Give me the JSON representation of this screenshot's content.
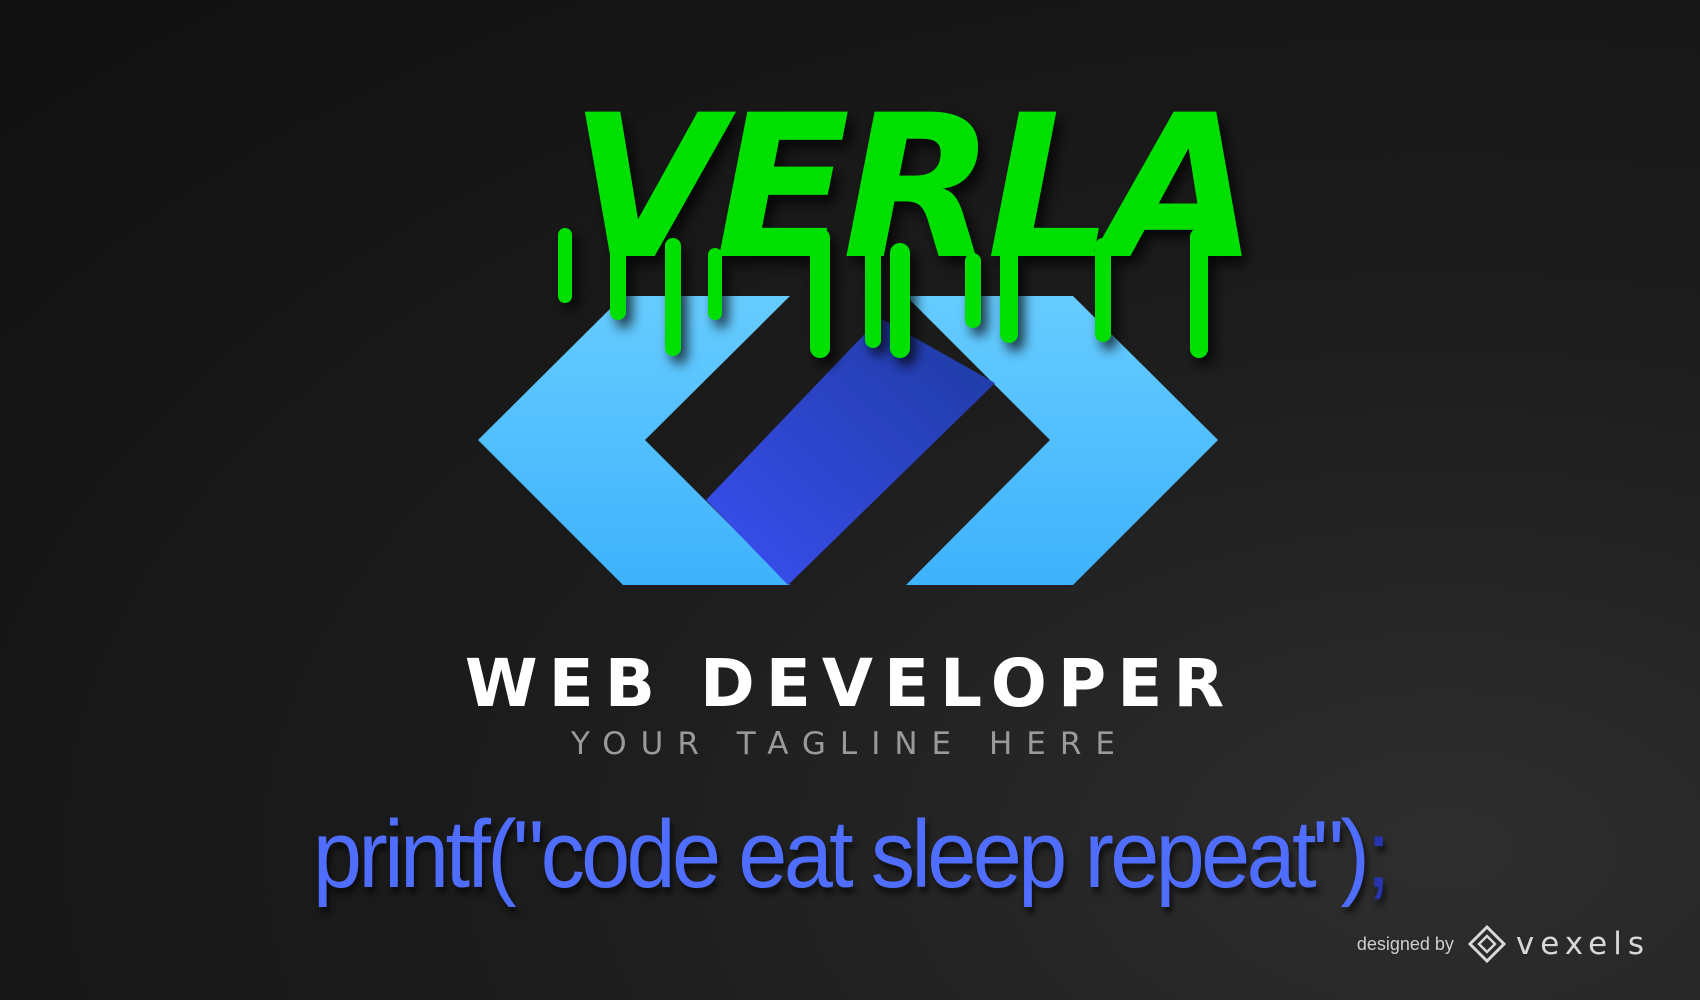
{
  "brand": {
    "name": "VERLA",
    "colors": {
      "slime": "#00e000",
      "bracket_light": "#66ccff",
      "bracket_dark": "#3eb2fc",
      "slash_light": "#3a4ff2",
      "slash_dark": "#1e3aa0"
    }
  },
  "title": "WEB DEVELOPER",
  "tagline": "YOUR TAGLINE HERE",
  "code": {
    "main": "printf(\"code eat sleep repeat\")",
    "semicolon": ";"
  },
  "credit": {
    "prefix": "designed by",
    "brand": "vexels",
    "icon": "vexels-diamond-icon"
  }
}
